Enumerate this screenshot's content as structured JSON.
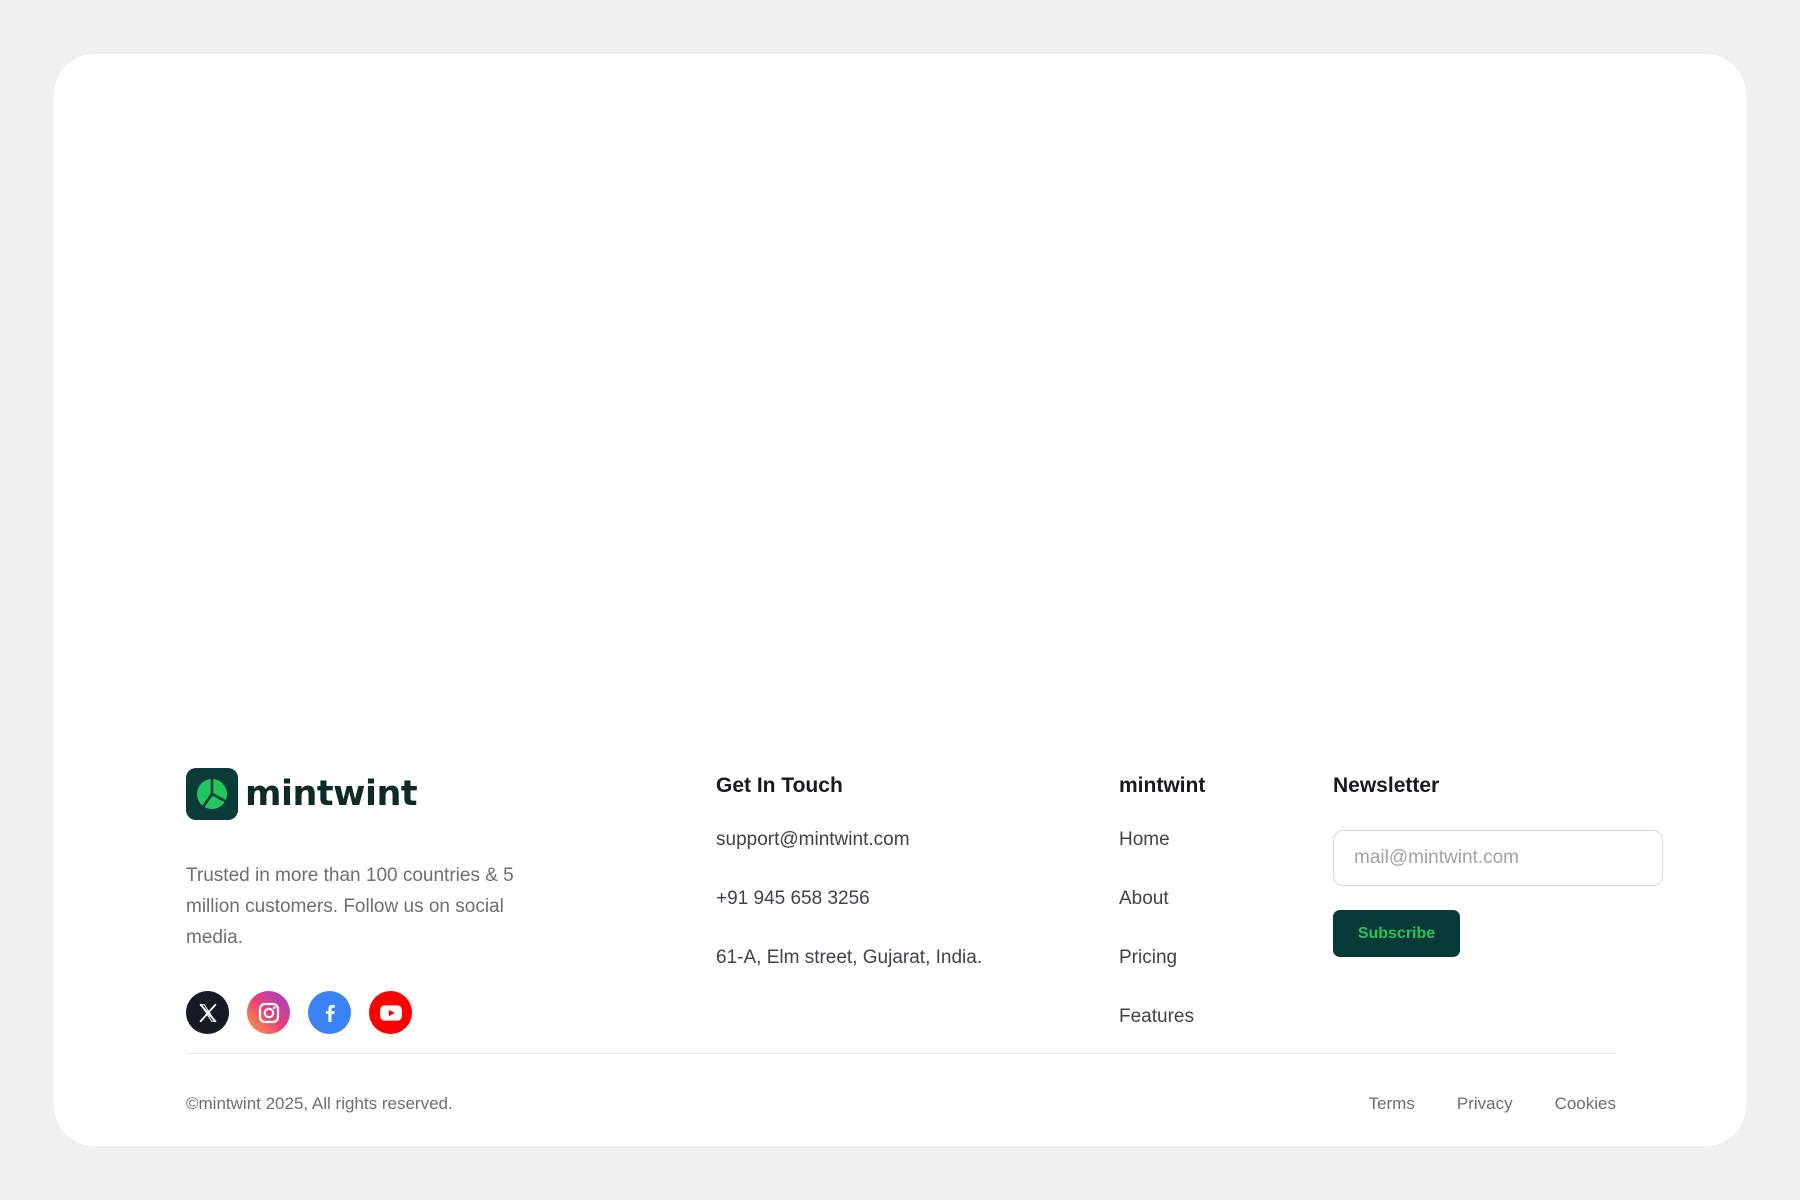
{
  "brand": {
    "name": "mintwint",
    "logo_icon": "pie-chart-leaf-icon",
    "tagline": "Trusted in more than 100 countries & 5 million customers. Follow us on social media."
  },
  "socials": [
    {
      "name": "X",
      "icon": "x-icon"
    },
    {
      "name": "Instagram",
      "icon": "instagram-icon"
    },
    {
      "name": "Facebook",
      "icon": "facebook-icon"
    },
    {
      "name": "YouTube",
      "icon": "youtube-icon"
    }
  ],
  "contact": {
    "heading": "Get In Touch",
    "email": "support@mintwint.com",
    "phone": "+91 945 658 3256",
    "address": "61-A, Elm street, Gujarat, India."
  },
  "links": {
    "heading": "mintwint",
    "items": [
      "Home",
      "About",
      "Pricing",
      "Features"
    ]
  },
  "newsletter": {
    "heading": "Newsletter",
    "placeholder": "mail@mintwint.com",
    "button_label": "Subscribe"
  },
  "bottom": {
    "copyright": "©mintwint 2025, All rights reserved.",
    "legal": [
      "Terms",
      "Privacy",
      "Cookies"
    ]
  },
  "colors": {
    "brand_dark": "#063a36",
    "brand_green": "#22c55e",
    "page_bg": "#f0f0f0",
    "card_bg": "#ffffff"
  }
}
